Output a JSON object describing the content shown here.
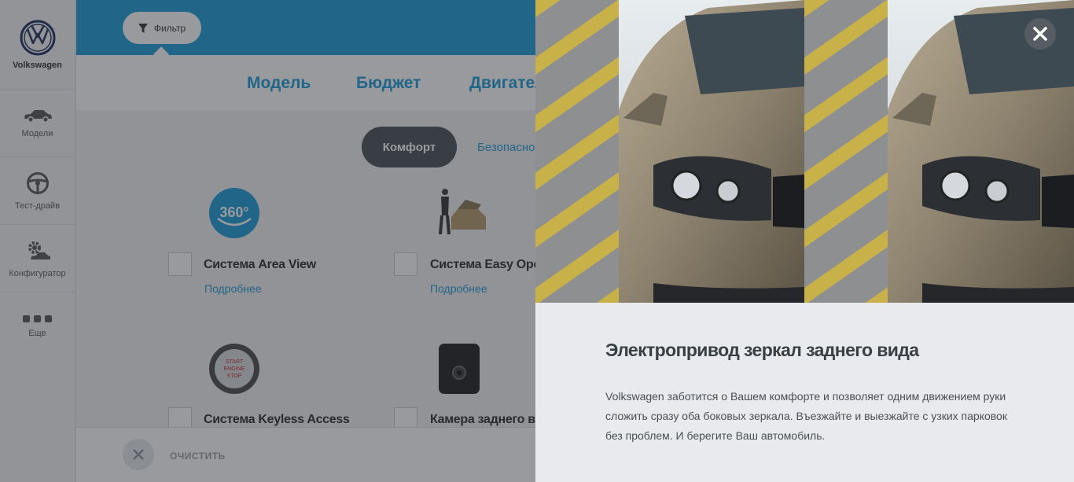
{
  "sidebar": {
    "brand": "Volkswagen",
    "items": [
      {
        "label": "Модели",
        "icon": "car-icon"
      },
      {
        "label": "Тест-драйв",
        "icon": "steering-wheel-icon"
      },
      {
        "label": "Конфигуратор",
        "icon": "configurator-gear-icon"
      },
      {
        "label": "Еще",
        "icon": "more-dots-icon"
      }
    ]
  },
  "topbar": {
    "filter_label": "Фильтр",
    "color": "#1c9ad6"
  },
  "tabs": [
    "Модель",
    "Бюджет",
    "Двигатель"
  ],
  "categories": {
    "active": "Комфорт",
    "next": "Безопасность"
  },
  "features": [
    {
      "title": "Система Area View",
      "more": "Подробнее",
      "icon": "360-camera-icon"
    },
    {
      "title": "Система Easy Open",
      "more": "Подробнее",
      "icon": "easy-open-trunk-icon"
    },
    {
      "title": "Система Keyless Access",
      "icon": "start-engine-button-icon"
    },
    {
      "title": "Камера заднего вида",
      "icon": "rear-camera-icon"
    }
  ],
  "bottombar": {
    "clear_label": "ОЧИСТИТЬ"
  },
  "modal": {
    "title": "Электропривод зеркал заднего вида",
    "description": "Volkswagen заботится о Вашем комфорте и позволяет одним движением руки сложить сразу оба боковых зеркала. Въезжайте и выезжайте с узких парковок без проблем. И берегите Ваш автомобиль."
  }
}
